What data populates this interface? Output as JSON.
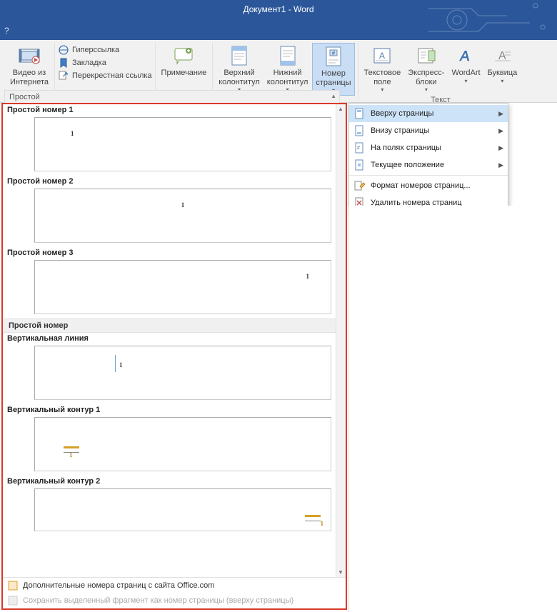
{
  "window": {
    "title": "Документ1 - Word",
    "help": "?"
  },
  "ribbon": {
    "video": {
      "l1": "Видео из",
      "l2": "Интернета"
    },
    "links": {
      "hyperlink": "Гиперссылка",
      "bookmark": "Закладка",
      "crossref": "Перекрестная ссылка"
    },
    "comment": "Примечание",
    "header": {
      "l1": "Верхний",
      "l2": "колонтитул"
    },
    "footer": {
      "l1": "Нижний",
      "l2": "колонтитул"
    },
    "pagenum": {
      "l1": "Номер",
      "l2": "страницы"
    },
    "textbox": {
      "l1": "Текстовое",
      "l2": "поле"
    },
    "quickparts": {
      "l1": "Экспресс-",
      "l2": "блоки"
    },
    "wordart": "WordArt",
    "dropcap": "Буквица",
    "textgroup": "Текст"
  },
  "menu": {
    "top": "Вверху страницы",
    "bottom": "Внизу страницы",
    "margins": "На полях страницы",
    "current": "Текущее положение",
    "format": "Формат номеров страниц...",
    "remove": "Удалить номера страниц"
  },
  "gallery": {
    "header": "Простой",
    "cat1": "Простой",
    "items": {
      "p1": "Простой номер 1",
      "p2": "Простой номер 2",
      "p3": "Простой номер 3",
      "vl": "Вертикальная линия",
      "vc1": "Вертикальный контур 1",
      "vc2": "Вертикальный контур 2"
    },
    "cat2": "Простой номер",
    "more": "Дополнительные номера страниц с сайта Office.com",
    "save": "Сохранить выделенный фрагмент как номер страницы (вверху страницы)"
  }
}
